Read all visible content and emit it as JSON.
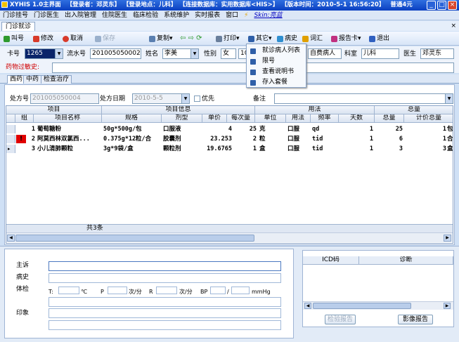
{
  "title": {
    "app": "XYHIS 1.0主界面",
    "login_user": "【登录者：邓灵东】",
    "login_place": "【登录地点：儿科】",
    "database": "【连接数据库：实用数据库<HIS>】",
    "version": "【版本时间：2010-5-1 16:56:20】",
    "mode": "普通4元"
  },
  "menu": {
    "items": [
      "门诊挂号",
      "门诊医生",
      "出入院管理",
      "住院医生",
      "临床检验",
      "系统维护",
      "实时报表",
      "窗口"
    ],
    "skin": "Skin:亮蓝"
  },
  "tab": {
    "label": "门诊就诊"
  },
  "toolbar": {
    "call": "叫号",
    "edit": "修改",
    "cancel": "取消",
    "save": "保存",
    "copy": "复制",
    "print": "打印",
    "other": "其它",
    "history": "病史",
    "phrase": "词汇",
    "report_card": "报告卡",
    "exit": "退出"
  },
  "info": {
    "card_label": "卡号",
    "card_value": "1265",
    "serial_label": "流水号",
    "serial_value": "201005050002",
    "name_label": "姓名",
    "name_value": "李美",
    "sex_label": "性别",
    "sex_value": "女",
    "age_value": "10",
    "patient_type": "自费病人",
    "dept_label": "科室",
    "dept_value": "儿科",
    "doctor_label": "医生",
    "doctor_value": "邓灵东"
  },
  "allergy": {
    "label": "药物过敏史:"
  },
  "subtabs": [
    "西药",
    "中药",
    "检查治疗"
  ],
  "form": {
    "rx_label": "处方号",
    "rx_value": "201005050004",
    "date_label": "处方日期",
    "date_value": "2010-5-5",
    "priority_label": "优先",
    "note_label": "备注"
  },
  "grid": {
    "group_headers": [
      "项目",
      "项目信息",
      "用法",
      "总量"
    ],
    "columns": [
      "组",
      "项目名称",
      "规格",
      "剂型",
      "单价",
      "每次量",
      "单位",
      "用法",
      "频率",
      "天数",
      "总量",
      "计价总量"
    ],
    "rows": [
      {
        "group": "1",
        "name": "葡萄糖粉",
        "spec": "50g*500g/包",
        "form": "口服液",
        "price": "4",
        "dose": "25",
        "unit": "克",
        "usage": "口服",
        "freq": "qd",
        "days": "1",
        "total": "25",
        "bill_total": "1",
        "bill_unit": "包",
        "warn": false
      },
      {
        "group": "2",
        "name": "阿莫西林双氯西...",
        "spec": "0.375g*12粒/合",
        "form": "胶囊剂",
        "price": "23.253",
        "dose": "2",
        "unit": "粒",
        "usage": "口服",
        "freq": "tid",
        "days": "1",
        "total": "6",
        "bill_total": "1",
        "bill_unit": "合",
        "warn": true
      },
      {
        "group": "3",
        "name": "小儿清肺颗粒",
        "spec": "3g*9袋/盒",
        "form": "颗粒剂",
        "price": "19.6765",
        "dose": "1",
        "unit": "盒",
        "usage": "口服",
        "freq": "tid",
        "days": "1",
        "total": "3",
        "bill_total": "3",
        "bill_unit": "盒",
        "warn": false
      }
    ],
    "footer": "共3条"
  },
  "exam": {
    "complaint": "主诉",
    "history": "病史",
    "physical": "体检",
    "impression": "印象",
    "t": "T:",
    "t_unit": "℃",
    "p": "P",
    "p_unit": "次/分",
    "r": "R",
    "r_unit": "次/分",
    "bp": "BP",
    "bp_sep": "/",
    "bp_unit": "mmHg"
  },
  "diagnosis": {
    "col_icd": "ICD码",
    "col_diag": "诊断",
    "btn_check": "检验报告",
    "btn_image": "影像报告"
  },
  "popup": {
    "items": [
      "就诊病人列表",
      "限号",
      "查看说明书",
      "存入套餐"
    ]
  },
  "colors": {
    "titlebar": "#0a3fc0",
    "background": "#cfe0f5",
    "warn": "#e00000"
  }
}
